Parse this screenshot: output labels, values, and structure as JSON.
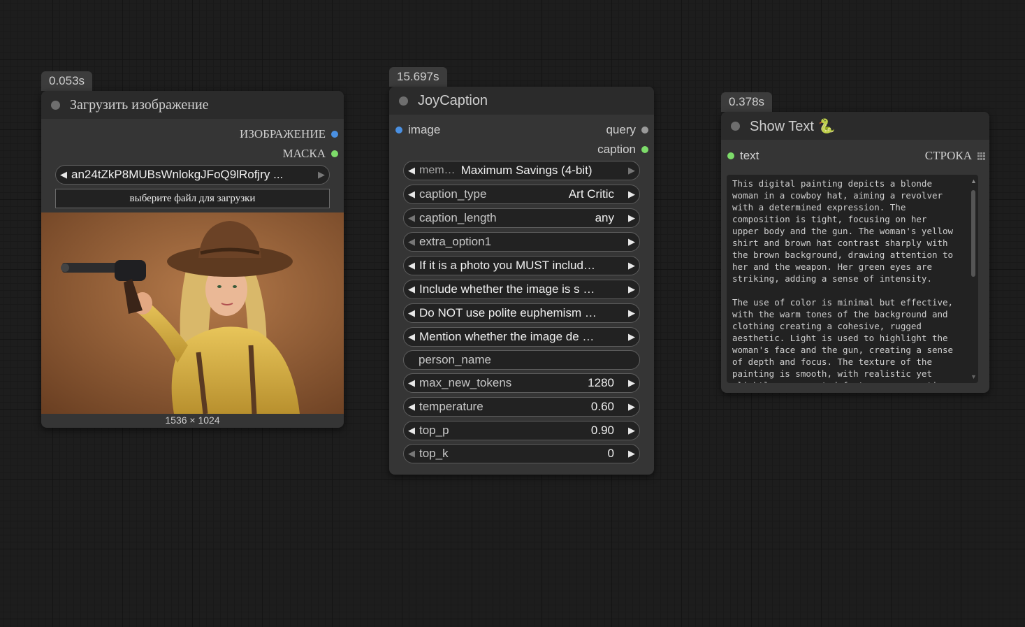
{
  "load_node": {
    "time": "0.053s",
    "title": "Загрузить изображение",
    "outputs": [
      "ИЗОБРАЖЕНИЕ",
      "МАСКА"
    ],
    "file_value": "an24tZkP8MUBsWnlokgJFoQ9lRofjry ...",
    "upload_button": "выберите файл для загрузки",
    "image_size": "1536 × 1024"
  },
  "joy_node": {
    "time": "15.697s",
    "title": "JoyCaption",
    "input": "image",
    "outputs": [
      "query",
      "caption"
    ],
    "widgets": [
      {
        "label": "mem…",
        "value": "Maximum Savings (4-bit)"
      },
      {
        "label": "caption_type",
        "value": "Art Critic"
      },
      {
        "label": "caption_length",
        "value": "any"
      },
      {
        "label": "extra_option1",
        "value": ""
      },
      {
        "label": "If it is a photo you MUST includ…",
        "value": ""
      },
      {
        "label": "Include whether the image is s …",
        "value": ""
      },
      {
        "label": "Do NOT use polite euphemism …",
        "value": ""
      },
      {
        "label": "Mention whether the image de …",
        "value": ""
      },
      {
        "label": "person_name",
        "value": ""
      },
      {
        "label": "max_new_tokens",
        "value": "1280"
      },
      {
        "label": "temperature",
        "value": "0.60"
      },
      {
        "label": "top_p",
        "value": "0.90"
      },
      {
        "label": "top_k",
        "value": "0"
      }
    ]
  },
  "show_node": {
    "time": "0.378s",
    "title": "Show Text 🐍",
    "input": "text",
    "output": "СТРОКА",
    "text_lines": [
      "This digital painting depicts a blonde",
      "woman in a cowboy hat, aiming a revolver",
      "with a determined expression. The",
      "composition is tight, focusing on her",
      "upper body and the gun. The woman's yellow",
      "shirt and brown hat contrast sharply with",
      "the brown background, drawing attention to",
      "her and the weapon. Her green eyes are",
      "striking, adding a sense of intensity.",
      "",
      "The use of color is minimal but effective,",
      "with the warm tones of the background and",
      "clothing creating a cohesive, rugged",
      "aesthetic. Light is used to highlight the",
      "woman's face and the gun, creating a sense",
      "of depth and focus. The texture of the",
      "painting is smooth, with realistic yet",
      "slightly exaggerated features, suggesting"
    ]
  },
  "colors": {
    "image_slot": "#4a90e2",
    "mask_slot": "#7ddc6a",
    "text_slot": "#7ddc6a",
    "caption_slot": "#7ddc6a",
    "query_slot": "#9a9a9a"
  }
}
